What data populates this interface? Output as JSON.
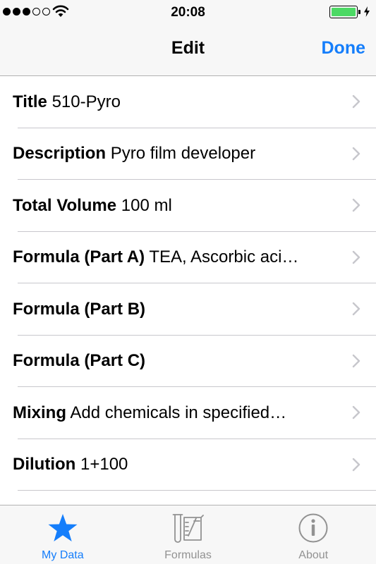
{
  "status_bar": {
    "time": "20:08",
    "signal_bars": 3,
    "signal_total": 5,
    "battery_level": 1.0
  },
  "nav": {
    "title": "Edit",
    "done_label": "Done"
  },
  "rows": [
    {
      "label": "Title",
      "value": "510-Pyro"
    },
    {
      "label": "Description",
      "value": "Pyro film developer"
    },
    {
      "label": "Total Volume",
      "value": "100 ml"
    },
    {
      "label": "Formula (Part A)",
      "value": "TEA, Ascorbic aci…"
    },
    {
      "label": "Formula (Part B)",
      "value": ""
    },
    {
      "label": "Formula (Part C)",
      "value": ""
    },
    {
      "label": "Mixing",
      "value": "Add chemicals in specified…"
    },
    {
      "label": "Dilution",
      "value": "1+100"
    }
  ],
  "tabs": [
    {
      "label": "My Data",
      "icon": "star-icon",
      "active": true
    },
    {
      "label": "Formulas",
      "icon": "formulas-icon",
      "active": false
    },
    {
      "label": "About",
      "icon": "info-icon",
      "active": false
    }
  ],
  "colors": {
    "accent": "#157efb",
    "battery": "#4cd964",
    "inactive": "#929292"
  }
}
